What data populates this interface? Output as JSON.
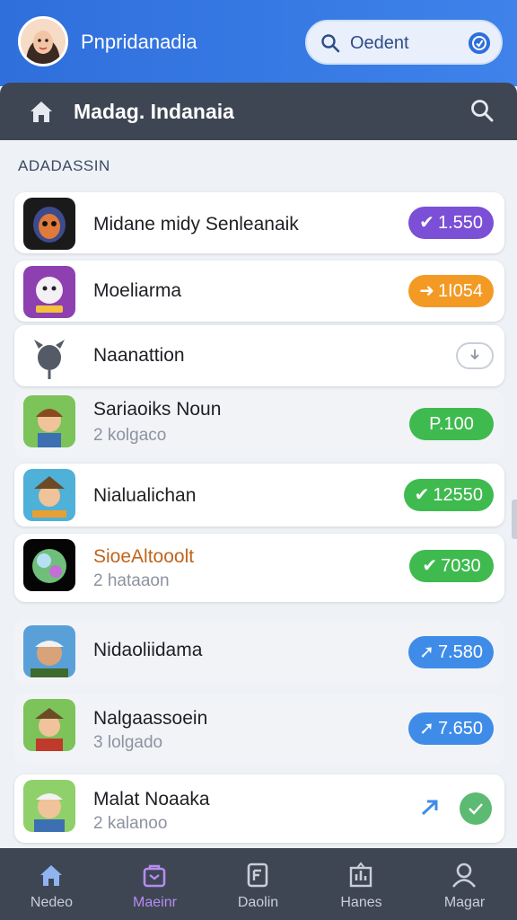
{
  "header": {
    "app_title": "Pnpridanadia",
    "search_value": "Oedent"
  },
  "subheader": {
    "title": "Madag. Indanaia"
  },
  "section": {
    "heading": "ADADASSIN"
  },
  "items": [
    {
      "name": "Midane midy Senleanaik",
      "subtitle": "",
      "badge": "1.550",
      "badge_color": "#7b4fd6",
      "arrow": "✔"
    },
    {
      "name": "Moeliarma",
      "subtitle": "",
      "badge": "1I054",
      "badge_color": "#f39a25",
      "arrow": "➜"
    },
    {
      "name": "Naanattion",
      "subtitle": "",
      "badge": "",
      "badge_color": "#ffffff",
      "arrow": ""
    },
    {
      "name": "Sariaoiks Noun",
      "subtitle": "2 kolgaco",
      "badge": "P.100",
      "badge_color": "#3fba4f",
      "arrow": ""
    },
    {
      "name": "Nialualichan",
      "subtitle": "",
      "badge": "12550",
      "badge_color": "#3fba4f",
      "arrow": "✔"
    },
    {
      "name": "SioeAltooolt",
      "subtitle": "2 hataaon",
      "badge": "7030",
      "badge_color": "#3fba4f",
      "arrow": "✔"
    },
    {
      "name": "Nidaoliidama",
      "subtitle": "",
      "badge": "7.580",
      "badge_color": "#3f8ce8",
      "arrow": "➚"
    },
    {
      "name": "Nalgaassoein",
      "subtitle": "3 lolgado",
      "badge": "7.650",
      "badge_color": "#3f8ce8",
      "arrow": "➚"
    },
    {
      "name": "Malat Noaaka",
      "subtitle": "2 kalanoo",
      "badge": "",
      "badge_color": "#5dba72",
      "arrow": ""
    }
  ],
  "nav": [
    {
      "label": "Nedeo"
    },
    {
      "label": "Maeinr"
    },
    {
      "label": "Daolin"
    },
    {
      "label": "Hanes"
    },
    {
      "label": "Magar"
    }
  ],
  "colors": {
    "header_blue": "#2f6fdc",
    "dark_bar": "#3e4653",
    "active_nav": "#b58cf2"
  }
}
